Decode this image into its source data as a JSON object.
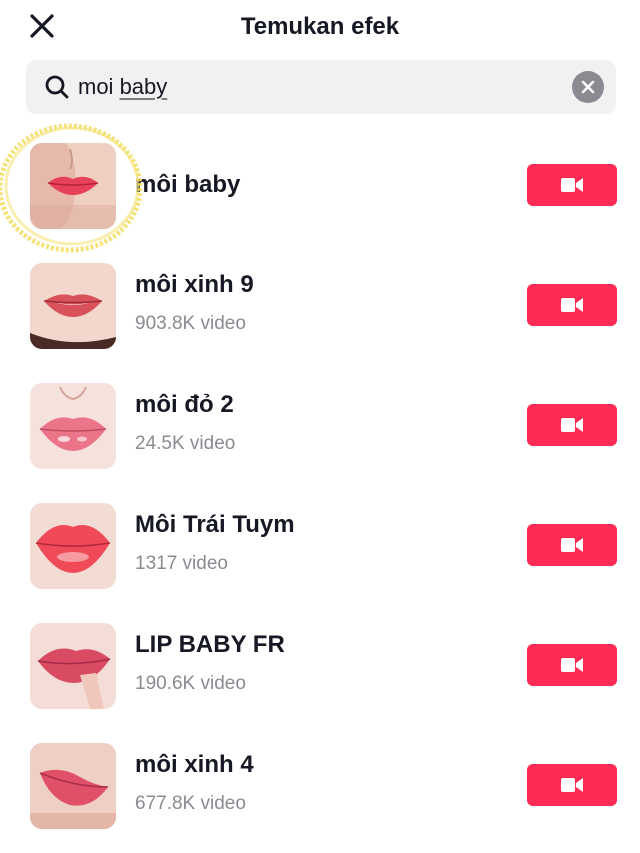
{
  "header": {
    "title": "Temukan efek",
    "close_icon": "close-icon"
  },
  "search": {
    "query_plain": "moi ",
    "query_spell": "baby",
    "search_icon": "search-icon",
    "clear_icon": "clear-icon"
  },
  "colors": {
    "accent": "#fe2c55",
    "text_primary": "#161823",
    "text_secondary": "#8a8b91",
    "search_bg": "#f1f1f2",
    "highlight": "#f5e27a"
  },
  "effects": [
    {
      "name": "môi baby",
      "count": "",
      "button_icon": "video-camera-icon"
    },
    {
      "name": "môi xinh 9",
      "count": "903.8K video",
      "button_icon": "video-camera-icon"
    },
    {
      "name": "môi đỏ 2",
      "count": "24.5K video",
      "button_icon": "video-camera-icon"
    },
    {
      "name": "Môi Trái Tuym",
      "count": "1317 video",
      "button_icon": "video-camera-icon"
    },
    {
      "name": "LIP BABY FR",
      "count": "190.6K video",
      "button_icon": "video-camera-icon"
    },
    {
      "name": "môi xinh 4",
      "count": "677.8K video",
      "button_icon": "video-camera-icon"
    }
  ]
}
